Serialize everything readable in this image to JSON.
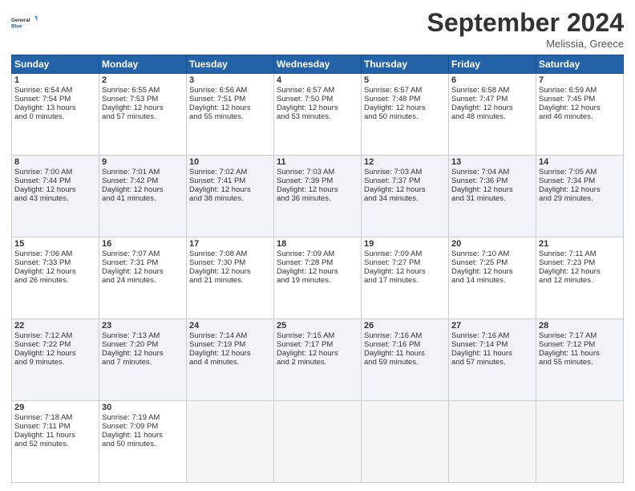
{
  "header": {
    "logo_line1": "General",
    "logo_line2": "Blue",
    "month_title": "September 2024",
    "location": "Melissia, Greece"
  },
  "days_of_week": [
    "Sunday",
    "Monday",
    "Tuesday",
    "Wednesday",
    "Thursday",
    "Friday",
    "Saturday"
  ],
  "weeks": [
    [
      {
        "day": "1",
        "lines": [
          "Sunrise: 6:54 AM",
          "Sunset: 7:54 PM",
          "Daylight: 13 hours",
          "and 0 minutes."
        ]
      },
      {
        "day": "2",
        "lines": [
          "Sunrise: 6:55 AM",
          "Sunset: 7:53 PM",
          "Daylight: 12 hours",
          "and 57 minutes."
        ]
      },
      {
        "day": "3",
        "lines": [
          "Sunrise: 6:56 AM",
          "Sunset: 7:51 PM",
          "Daylight: 12 hours",
          "and 55 minutes."
        ]
      },
      {
        "day": "4",
        "lines": [
          "Sunrise: 6:57 AM",
          "Sunset: 7:50 PM",
          "Daylight: 12 hours",
          "and 53 minutes."
        ]
      },
      {
        "day": "5",
        "lines": [
          "Sunrise: 6:57 AM",
          "Sunset: 7:48 PM",
          "Daylight: 12 hours",
          "and 50 minutes."
        ]
      },
      {
        "day": "6",
        "lines": [
          "Sunrise: 6:58 AM",
          "Sunset: 7:47 PM",
          "Daylight: 12 hours",
          "and 48 minutes."
        ]
      },
      {
        "day": "7",
        "lines": [
          "Sunrise: 6:59 AM",
          "Sunset: 7:45 PM",
          "Daylight: 12 hours",
          "and 46 minutes."
        ]
      }
    ],
    [
      {
        "day": "8",
        "lines": [
          "Sunrise: 7:00 AM",
          "Sunset: 7:44 PM",
          "Daylight: 12 hours",
          "and 43 minutes."
        ]
      },
      {
        "day": "9",
        "lines": [
          "Sunrise: 7:01 AM",
          "Sunset: 7:42 PM",
          "Daylight: 12 hours",
          "and 41 minutes."
        ]
      },
      {
        "day": "10",
        "lines": [
          "Sunrise: 7:02 AM",
          "Sunset: 7:41 PM",
          "Daylight: 12 hours",
          "and 38 minutes."
        ]
      },
      {
        "day": "11",
        "lines": [
          "Sunrise: 7:03 AM",
          "Sunset: 7:39 PM",
          "Daylight: 12 hours",
          "and 36 minutes."
        ]
      },
      {
        "day": "12",
        "lines": [
          "Sunrise: 7:03 AM",
          "Sunset: 7:37 PM",
          "Daylight: 12 hours",
          "and 34 minutes."
        ]
      },
      {
        "day": "13",
        "lines": [
          "Sunrise: 7:04 AM",
          "Sunset: 7:36 PM",
          "Daylight: 12 hours",
          "and 31 minutes."
        ]
      },
      {
        "day": "14",
        "lines": [
          "Sunrise: 7:05 AM",
          "Sunset: 7:34 PM",
          "Daylight: 12 hours",
          "and 29 minutes."
        ]
      }
    ],
    [
      {
        "day": "15",
        "lines": [
          "Sunrise: 7:06 AM",
          "Sunset: 7:33 PM",
          "Daylight: 12 hours",
          "and 26 minutes."
        ]
      },
      {
        "day": "16",
        "lines": [
          "Sunrise: 7:07 AM",
          "Sunset: 7:31 PM",
          "Daylight: 12 hours",
          "and 24 minutes."
        ]
      },
      {
        "day": "17",
        "lines": [
          "Sunrise: 7:08 AM",
          "Sunset: 7:30 PM",
          "Daylight: 12 hours",
          "and 21 minutes."
        ]
      },
      {
        "day": "18",
        "lines": [
          "Sunrise: 7:09 AM",
          "Sunset: 7:28 PM",
          "Daylight: 12 hours",
          "and 19 minutes."
        ]
      },
      {
        "day": "19",
        "lines": [
          "Sunrise: 7:09 AM",
          "Sunset: 7:27 PM",
          "Daylight: 12 hours",
          "and 17 minutes."
        ]
      },
      {
        "day": "20",
        "lines": [
          "Sunrise: 7:10 AM",
          "Sunset: 7:25 PM",
          "Daylight: 12 hours",
          "and 14 minutes."
        ]
      },
      {
        "day": "21",
        "lines": [
          "Sunrise: 7:11 AM",
          "Sunset: 7:23 PM",
          "Daylight: 12 hours",
          "and 12 minutes."
        ]
      }
    ],
    [
      {
        "day": "22",
        "lines": [
          "Sunrise: 7:12 AM",
          "Sunset: 7:22 PM",
          "Daylight: 12 hours",
          "and 9 minutes."
        ]
      },
      {
        "day": "23",
        "lines": [
          "Sunrise: 7:13 AM",
          "Sunset: 7:20 PM",
          "Daylight: 12 hours",
          "and 7 minutes."
        ]
      },
      {
        "day": "24",
        "lines": [
          "Sunrise: 7:14 AM",
          "Sunset: 7:19 PM",
          "Daylight: 12 hours",
          "and 4 minutes."
        ]
      },
      {
        "day": "25",
        "lines": [
          "Sunrise: 7:15 AM",
          "Sunset: 7:17 PM",
          "Daylight: 12 hours",
          "and 2 minutes."
        ]
      },
      {
        "day": "26",
        "lines": [
          "Sunrise: 7:16 AM",
          "Sunset: 7:16 PM",
          "Daylight: 11 hours",
          "and 59 minutes."
        ]
      },
      {
        "day": "27",
        "lines": [
          "Sunrise: 7:16 AM",
          "Sunset: 7:14 PM",
          "Daylight: 11 hours",
          "and 57 minutes."
        ]
      },
      {
        "day": "28",
        "lines": [
          "Sunrise: 7:17 AM",
          "Sunset: 7:12 PM",
          "Daylight: 11 hours",
          "and 55 minutes."
        ]
      }
    ],
    [
      {
        "day": "29",
        "lines": [
          "Sunrise: 7:18 AM",
          "Sunset: 7:11 PM",
          "Daylight: 11 hours",
          "and 52 minutes."
        ]
      },
      {
        "day": "30",
        "lines": [
          "Sunrise: 7:19 AM",
          "Sunset: 7:09 PM",
          "Daylight: 11 hours",
          "and 50 minutes."
        ]
      },
      {
        "day": "",
        "lines": []
      },
      {
        "day": "",
        "lines": []
      },
      {
        "day": "",
        "lines": []
      },
      {
        "day": "",
        "lines": []
      },
      {
        "day": "",
        "lines": []
      }
    ]
  ]
}
